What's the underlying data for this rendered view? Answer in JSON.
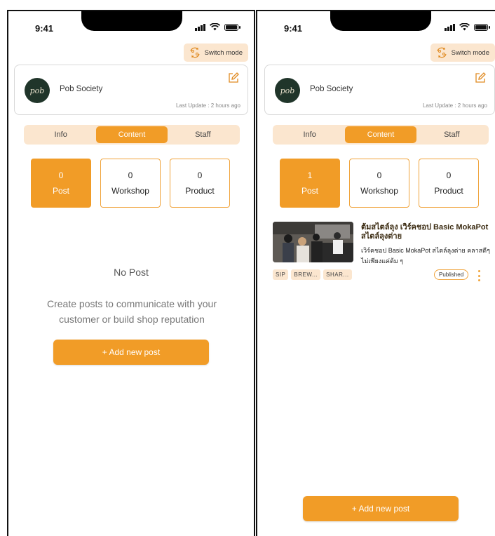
{
  "screens": [
    {
      "status_time": "9:41",
      "switch_mode_label": "Switch mode",
      "shop": {
        "logo_text": "pob",
        "name": "Pob Society",
        "last_update": "Last Update : 2 hours ago"
      },
      "tabs": [
        {
          "label": "Info",
          "active": false
        },
        {
          "label": "Content",
          "active": true
        },
        {
          "label": "Staff",
          "active": false
        }
      ],
      "counters": [
        {
          "count": "0",
          "label": "Post",
          "active": true
        },
        {
          "count": "0",
          "label": "Workshop",
          "active": false
        },
        {
          "count": "0",
          "label": "Product",
          "active": false
        }
      ],
      "empty_state": {
        "title": "No Post",
        "description": "Create posts to communicate with your customer or build shop reputation"
      },
      "add_button_label": "+ Add new post"
    },
    {
      "status_time": "9:41",
      "switch_mode_label": "Switch mode",
      "shop": {
        "logo_text": "pob",
        "name": "Pob Society",
        "last_update": "Last Update : 2 hours ago"
      },
      "tabs": [
        {
          "label": "Info",
          "active": false
        },
        {
          "label": "Content",
          "active": true
        },
        {
          "label": "Staff",
          "active": false
        }
      ],
      "counters": [
        {
          "count": "1",
          "label": "Post",
          "active": true
        },
        {
          "count": "0",
          "label": "Workshop",
          "active": false
        },
        {
          "count": "0",
          "label": "Product",
          "active": false
        }
      ],
      "posts": [
        {
          "title": "ต้มสไตล์ลุง เวิร์คชอป Basic MokaPot สไตล์ลุงต่าย",
          "excerpt": "เวิร์คชอป Basic MokaPot สไตล์ลุงต่าย คลาสดีๆ ไม่เพียงแค่ต้ม ๆ",
          "tags": [
            "SIP",
            "BREW...",
            "SHAR..."
          ],
          "status": "Published"
        }
      ],
      "add_button_label": "+ Add new post"
    }
  ],
  "colors": {
    "accent": "#f19c27",
    "accent_light": "#fbe6cf",
    "logo_bg": "#20352a"
  },
  "icons": [
    "signal-icon",
    "wifi-icon",
    "battery-icon",
    "switch-mode-icon",
    "edit-icon",
    "more-vertical-icon"
  ]
}
